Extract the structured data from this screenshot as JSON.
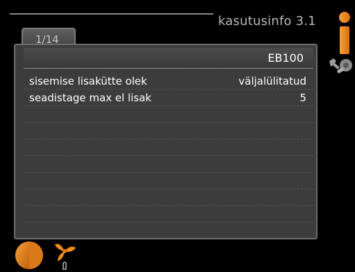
{
  "header": {
    "title": "kasutusinfo 3.1"
  },
  "tab": {
    "label": "1/14"
  },
  "panel": {
    "heading": "EB100",
    "rows": [
      {
        "label": "sisemise lisakütte olek",
        "value": "väljalülitatud"
      },
      {
        "label": "seadistage max el lisak",
        "value": "5"
      },
      {
        "label": "",
        "value": ""
      },
      {
        "label": "",
        "value": ""
      },
      {
        "label": "",
        "value": ""
      },
      {
        "label": "",
        "value": ""
      },
      {
        "label": "",
        "value": ""
      },
      {
        "label": "",
        "value": ""
      },
      {
        "label": "",
        "value": ""
      },
      {
        "label": "",
        "value": ""
      }
    ]
  },
  "icons": {
    "info": "info-icon",
    "tools": "tools-icon",
    "heating": "half-circle-icon",
    "fan": "fan-icon"
  },
  "colors": {
    "background": "#000000",
    "panel": "#3c3c3c",
    "accent_orange": "#f08a1a",
    "title_gray": "#b9b9b9"
  }
}
